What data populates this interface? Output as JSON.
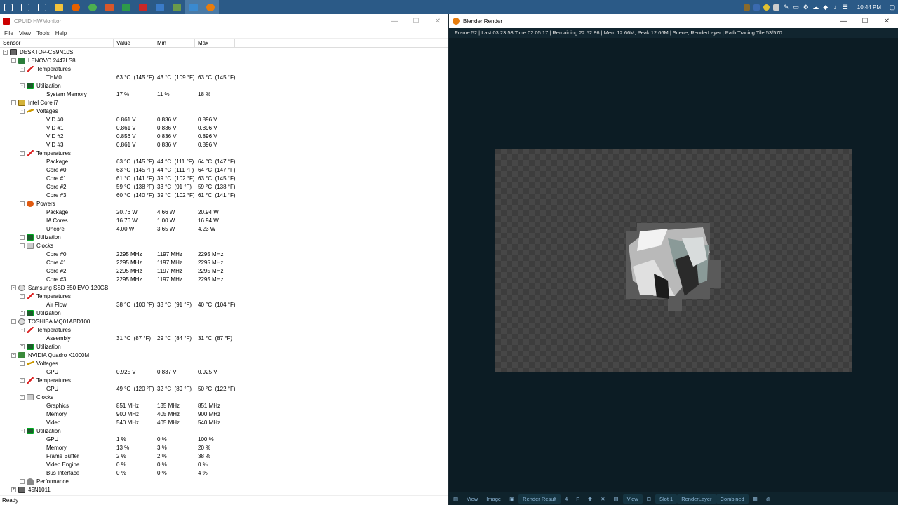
{
  "taskbar": {
    "buttons": [
      {
        "icon": "windows-icon",
        "color": "#ffffff"
      },
      {
        "icon": "search-icon",
        "color": "#ffffff"
      },
      {
        "icon": "task-view-icon",
        "color": "#ffffff"
      },
      {
        "icon": "file-explorer-icon",
        "color": "#f3c33b"
      },
      {
        "icon": "firefox-icon",
        "color": "#e66000"
      },
      {
        "icon": "chrome-icon",
        "color": "#4caf50"
      },
      {
        "icon": "app-icon",
        "color": "#d8572a"
      },
      {
        "icon": "app-icon",
        "color": "#2d9a4a"
      },
      {
        "icon": "app-icon",
        "color": "#c62828"
      },
      {
        "icon": "app-icon",
        "color": "#3a7bc8"
      },
      {
        "icon": "app-icon",
        "color": "#6a9a4a"
      },
      {
        "icon": "hwmonitor-icon",
        "color": "#3a8ad0"
      },
      {
        "icon": "blender-icon",
        "color": "#e87d0d"
      }
    ],
    "clock": "10:44 PM"
  },
  "hwmonitor": {
    "title": "CPUID HWMonitor",
    "menu": [
      "File",
      "View",
      "Tools",
      "Help"
    ],
    "columns": [
      "Sensor",
      "Value",
      "Min",
      "Max"
    ],
    "rows": [
      {
        "level": 0,
        "icon": "pc",
        "expander": "-",
        "name": "DESKTOP-CS9N10S"
      },
      {
        "level": 1,
        "icon": "board",
        "expander": "-",
        "name": "LENOVO 2447LS8"
      },
      {
        "level": 2,
        "icon": "temp",
        "expander": "-",
        "name": "Temperatures"
      },
      {
        "level": 3,
        "name": "THM0",
        "value": "63 °C  (145 °F)",
        "min": "43 °C  (109 °F)",
        "max": "63 °C  (145 °F)"
      },
      {
        "level": 2,
        "icon": "util",
        "expander": "-",
        "name": "Utilization"
      },
      {
        "level": 3,
        "name": "System Memory",
        "value": "17 %",
        "min": "11 %",
        "max": "18 %"
      },
      {
        "level": 1,
        "icon": "cpu",
        "expander": "-",
        "name": "Intel Core i7"
      },
      {
        "level": 2,
        "icon": "volt",
        "expander": "-",
        "name": "Voltages"
      },
      {
        "level": 3,
        "name": "VID #0",
        "value": "0.861 V",
        "min": "0.836 V",
        "max": "0.896 V"
      },
      {
        "level": 3,
        "name": "VID #1",
        "value": "0.861 V",
        "min": "0.836 V",
        "max": "0.896 V"
      },
      {
        "level": 3,
        "name": "VID #2",
        "value": "0.856 V",
        "min": "0.836 V",
        "max": "0.896 V"
      },
      {
        "level": 3,
        "name": "VID #3",
        "value": "0.861 V",
        "min": "0.836 V",
        "max": "0.896 V"
      },
      {
        "level": 2,
        "icon": "temp",
        "expander": "-",
        "name": "Temperatures"
      },
      {
        "level": 3,
        "name": "Package",
        "value": "63 °C  (145 °F)",
        "min": "44 °C  (111 °F)",
        "max": "64 °C  (147 °F)"
      },
      {
        "level": 3,
        "name": "Core #0",
        "value": "63 °C  (145 °F)",
        "min": "44 °C  (111 °F)",
        "max": "64 °C  (147 °F)"
      },
      {
        "level": 3,
        "name": "Core #1",
        "value": "61 °C  (141 °F)",
        "min": "39 °C  (102 °F)",
        "max": "63 °C  (145 °F)"
      },
      {
        "level": 3,
        "name": "Core #2",
        "value": "59 °C  (138 °F)",
        "min": "33 °C  (91 °F)",
        "max": "59 °C  (138 °F)"
      },
      {
        "level": 3,
        "name": "Core #3",
        "value": "60 °C  (140 °F)",
        "min": "39 °C  (102 °F)",
        "max": "61 °C  (141 °F)"
      },
      {
        "level": 2,
        "icon": "power",
        "expander": "-",
        "name": "Powers"
      },
      {
        "level": 3,
        "name": "Package",
        "value": "20.76 W",
        "min": "4.66 W",
        "max": "20.94 W"
      },
      {
        "level": 3,
        "name": "IA Cores",
        "value": "16.76 W",
        "min": "1.00 W",
        "max": "16.94 W"
      },
      {
        "level": 3,
        "name": "Uncore",
        "value": "4.00 W",
        "min": "3.65 W",
        "max": "4.23 W"
      },
      {
        "level": 2,
        "icon": "util",
        "expander": "+",
        "name": "Utilization"
      },
      {
        "level": 2,
        "icon": "clock",
        "expander": "-",
        "name": "Clocks"
      },
      {
        "level": 3,
        "name": "Core #0",
        "value": "2295 MHz",
        "min": "1197 MHz",
        "max": "2295 MHz"
      },
      {
        "level": 3,
        "name": "Core #1",
        "value": "2295 MHz",
        "min": "1197 MHz",
        "max": "2295 MHz"
      },
      {
        "level": 3,
        "name": "Core #2",
        "value": "2295 MHz",
        "min": "1197 MHz",
        "max": "2295 MHz"
      },
      {
        "level": 3,
        "name": "Core #3",
        "value": "2295 MHz",
        "min": "1197 MHz",
        "max": "2295 MHz"
      },
      {
        "level": 1,
        "icon": "disk",
        "expander": "-",
        "name": "Samsung SSD 850 EVO 120GB"
      },
      {
        "level": 2,
        "icon": "temp",
        "expander": "-",
        "name": "Temperatures"
      },
      {
        "level": 3,
        "name": "Air Flow",
        "value": "38 °C  (100 °F)",
        "min": "33 °C  (91 °F)",
        "max": "40 °C  (104 °F)"
      },
      {
        "level": 2,
        "icon": "util",
        "expander": "+",
        "name": "Utilization"
      },
      {
        "level": 1,
        "icon": "disk",
        "expander": "-",
        "name": "TOSHIBA MQ01ABD100"
      },
      {
        "level": 2,
        "icon": "temp",
        "expander": "-",
        "name": "Temperatures"
      },
      {
        "level": 3,
        "name": "Assembly",
        "value": "31 °C  (87 °F)",
        "min": "29 °C  (84 °F)",
        "max": "31 °C  (87 °F)"
      },
      {
        "level": 2,
        "icon": "util",
        "expander": "+",
        "name": "Utilization"
      },
      {
        "level": 1,
        "icon": "gpu",
        "expander": "-",
        "name": "NVIDIA Quadro K1000M"
      },
      {
        "level": 2,
        "icon": "volt",
        "expander": "-",
        "name": "Voltages"
      },
      {
        "level": 3,
        "name": "GPU",
        "value": "0.925 V",
        "min": "0.837 V",
        "max": "0.925 V"
      },
      {
        "level": 2,
        "icon": "temp",
        "expander": "-",
        "name": "Temperatures"
      },
      {
        "level": 3,
        "name": "GPU",
        "value": "49 °C  (120 °F)",
        "min": "32 °C  (89 °F)",
        "max": "50 °C  (122 °F)"
      },
      {
        "level": 2,
        "icon": "clock",
        "expander": "-",
        "name": "Clocks"
      },
      {
        "level": 3,
        "name": "Graphics",
        "value": "851 MHz",
        "min": "135 MHz",
        "max": "851 MHz"
      },
      {
        "level": 3,
        "name": "Memory",
        "value": "900 MHz",
        "min": "405 MHz",
        "max": "900 MHz"
      },
      {
        "level": 3,
        "name": "Video",
        "value": "540 MHz",
        "min": "405 MHz",
        "max": "540 MHz"
      },
      {
        "level": 2,
        "icon": "util",
        "expander": "-",
        "name": "Utilization"
      },
      {
        "level": 3,
        "name": "GPU",
        "value": "1 %",
        "min": "0 %",
        "max": "100 %"
      },
      {
        "level": 3,
        "name": "Memory",
        "value": "13 %",
        "min": "3 %",
        "max": "20 %"
      },
      {
        "level": 3,
        "name": "Frame Buffer",
        "value": "2 %",
        "min": "2 %",
        "max": "38 %"
      },
      {
        "level": 3,
        "name": "Video Engine",
        "value": "0 %",
        "min": "0 %",
        "max": "0 %"
      },
      {
        "level": 3,
        "name": "Bus Interface",
        "value": "0 %",
        "min": "0 %",
        "max": "4 %"
      },
      {
        "level": 2,
        "icon": "perf",
        "expander": "+",
        "name": "Performance"
      },
      {
        "level": 1,
        "icon": "pc",
        "expander": "+",
        "name": "45N1011"
      }
    ],
    "status": "Ready"
  },
  "blender": {
    "title": "Blender Render",
    "info": "Frame:52 | Last:03:23.53 Time:02:05.17 | Remaining:22:52.86 | Mem:12.66M, Peak:12.66M | Scene, RenderLayer | Path Tracing Tile 53/570",
    "footer": {
      "view": "View",
      "image": "Image",
      "render_result": "Render Result",
      "users": "4",
      "fake": "F",
      "view2": "View",
      "slot": "Slot 1",
      "layer": "RenderLayer",
      "pass": "Combined"
    }
  }
}
